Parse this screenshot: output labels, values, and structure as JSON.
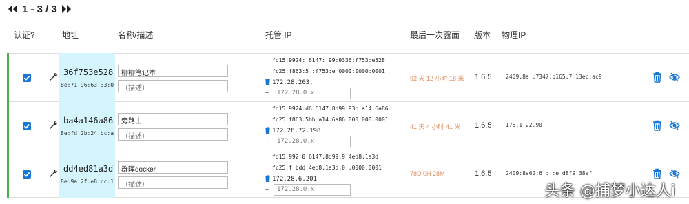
{
  "pager": {
    "text": "1 - 3 / 3"
  },
  "columns": {
    "auth": "认证?",
    "address": "地址",
    "name_desc": "名称/描述",
    "managed_ip": "托管 IP",
    "last_seen": "最后一次露面",
    "version": "版本",
    "physical_ip": "物理IP"
  },
  "members": [
    {
      "authorized": true,
      "address": "36f753e528",
      "mac": "8e:71:96:63:33:0",
      "name": "柳柳笔记本",
      "desc_placeholder": "（描述）",
      "ip6_a": "fd15:9924:        6147:      99:9336:f753:e528",
      "ip6_b": "fc25:f863:5     :f753:e        0000:0000:0001",
      "ip4": "172.28.203.",
      "new_ip_placeholder": "172.28.0.x",
      "last_seen": "92 天 12 小时 18 米",
      "version": "1.6.5",
      "physical_ip": "2409:8a      :7347:b165:7      13ec:ac9"
    },
    {
      "authorized": true,
      "address": "ba4a146a86",
      "mac": "8e:fd:2b:24:bc:a",
      "name": "旁路由",
      "desc_placeholder": "（描述）",
      "ip6_a": "fd15:9924:d6    6147:8d99:93b    a14:6a86",
      "ip6_b": "fc25:f863:5bb     a14:6a86:000   000:0001",
      "ip4": "172.28.72.198",
      "new_ip_placeholder": "172.28.0.x",
      "last_seen": "41 天 4 小时 41 米",
      "version": "1.6.5",
      "physical_ip": "175.1     22.90"
    },
    {
      "authorized": true,
      "address": "dd4ed81a3d",
      "mac": "8e:9a:2f:e8:cc:1",
      "name": "群晖docker",
      "desc_placeholder": "（描述）",
      "ip6_a": "fd15:992     0:6147:8d99:9     4ed8:1a3d",
      "ip6_b": "fc25:f      bdd:4ed8:1a3d:0      :0000:0001",
      "ip4": "172.28.6.201",
      "new_ip_placeholder": "172.28.0.x",
      "last_seen": "78D 0H 28M",
      "version": "1.6.5",
      "physical_ip": "2409:8a62:6      :      :e      d8f9:38af"
    }
  ],
  "watermark": "头条 @捕梦小达人i",
  "colors": {
    "accent": "#1976d2",
    "online_bar": "#4caf50",
    "seen": "#e08c5e",
    "address_bg": "#d4f5fd"
  }
}
